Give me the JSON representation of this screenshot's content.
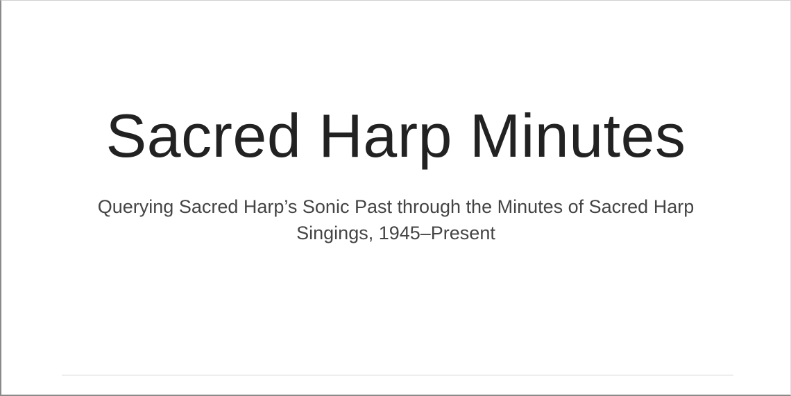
{
  "hero": {
    "title": "Sacred Harp Minutes",
    "subtitle": "Querying Sacred Harp’s Sonic Past through the Minutes of Sacred Harp Singings, 1945–Present"
  }
}
